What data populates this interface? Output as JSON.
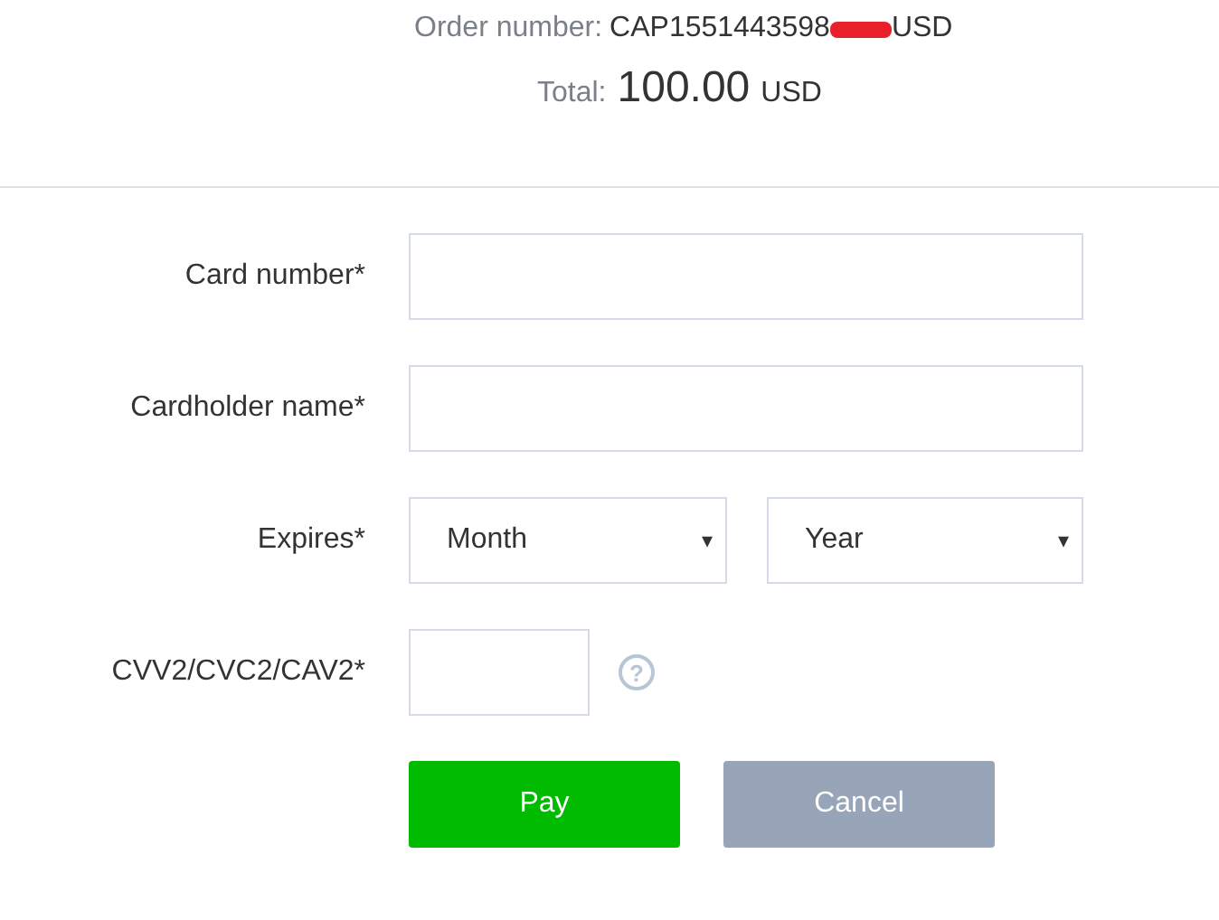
{
  "order": {
    "label": "Order number:",
    "value": "CAP1551443598",
    "redacted": true,
    "suffix": "USD"
  },
  "total": {
    "label": "Total:",
    "amount": "100.00",
    "currency": "USD"
  },
  "fields": [
    {
      "kind": "text",
      "label": "Card number*"
    },
    {
      "kind": "text",
      "label": "Cardholder name*"
    },
    {
      "kind": "selects",
      "label": "Expires*",
      "selects": [
        {
          "value": "Month",
          "caret": "▾"
        },
        {
          "value": "Year",
          "caret": "▾"
        }
      ]
    },
    {
      "kind": "cvv",
      "label": "CVV2/CVC2/CAV2*",
      "help": "?"
    }
  ],
  "buttons": [
    {
      "label": "Pay",
      "kind": "primary",
      "disabled": false
    },
    {
      "label": "Cancel",
      "kind": "secondary",
      "disabled": true
    }
  ]
}
